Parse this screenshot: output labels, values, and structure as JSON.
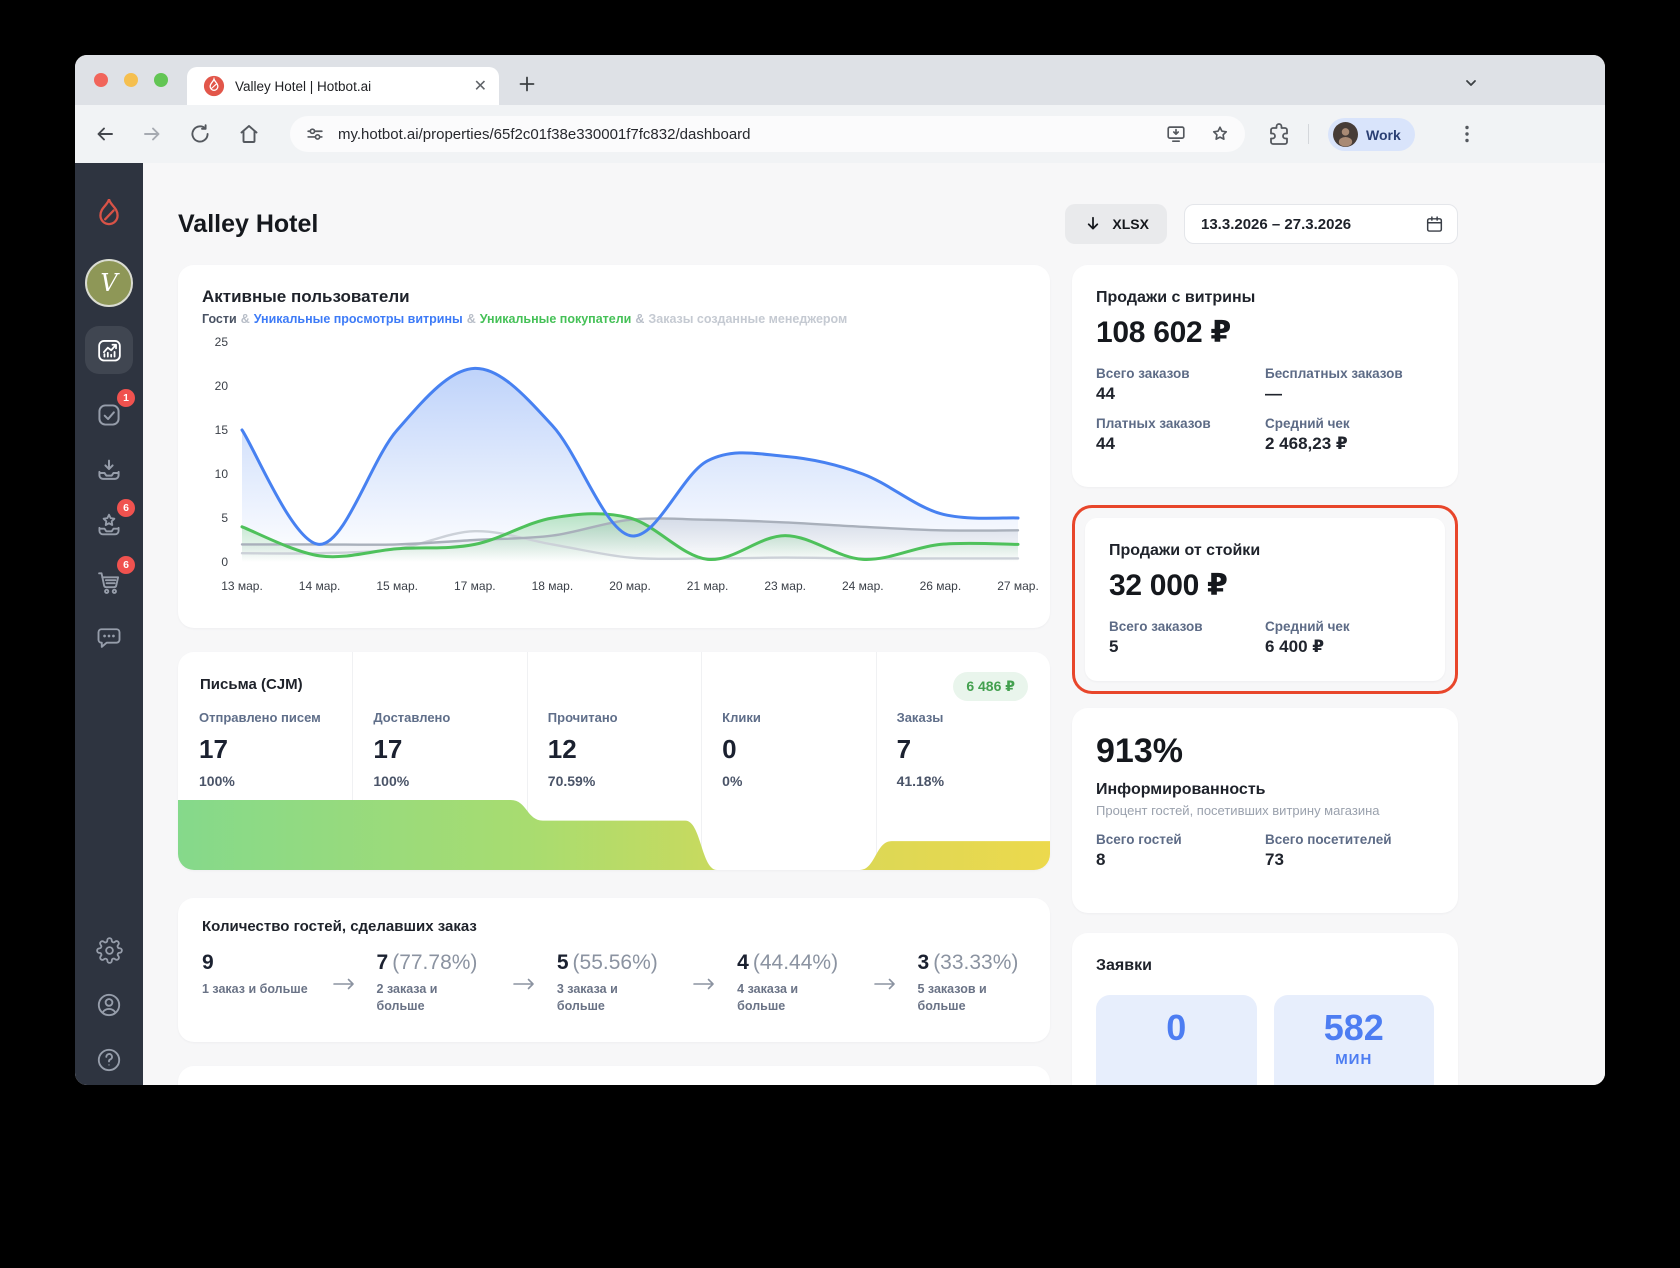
{
  "browser": {
    "tab_title": "Valley Hotel | Hotbot.ai",
    "url": "my.hotbot.ai/properties/65f2c01f38e330001f7fc832/dashboard",
    "profile_label": "Work"
  },
  "sidebar": {
    "tasks_badge": "1",
    "loyalty_badge": "6",
    "cart_badge": "6"
  },
  "header": {
    "title": "Valley Hotel",
    "xlsx_label": "XLSX",
    "date_range": "13.3.2026 – 27.3.2026"
  },
  "chart_data": {
    "type": "area",
    "title": "Активные пользователи",
    "separator": "&",
    "x_labels": [
      "13 мар.",
      "14 мар.",
      "15 мар.",
      "17 мар.",
      "18 мар.",
      "20 мар.",
      "21 мар.",
      "23 мар.",
      "24 мар.",
      "26 мар.",
      "27 мар."
    ],
    "ylim": [
      0,
      25
    ],
    "yticks": [
      0,
      5,
      10,
      15,
      20,
      25
    ],
    "series": [
      {
        "name": "Гости",
        "color": "#a9b0bb",
        "legend_color": "#495263",
        "fill": true,
        "values": [
          2,
          2,
          2,
          2.5,
          3,
          4.8,
          4.8,
          4.5,
          4,
          3.6,
          3.6
        ]
      },
      {
        "name": "Уникальные просмотры витрины",
        "color": "#4781f1",
        "legend_color": "#3d7bf7",
        "fill": true,
        "values": [
          15,
          2,
          15,
          22,
          15.5,
          3,
          11.5,
          12,
          10,
          5.5,
          5
        ]
      },
      {
        "name": "Уникальные покупатели",
        "color": "#4ec15b",
        "legend_color": "#45c157",
        "fill": true,
        "values": [
          4,
          0.7,
          1.5,
          2,
          5,
          5,
          0.3,
          3,
          0.3,
          2,
          2
        ]
      },
      {
        "name": "Заказы созданные менеджером",
        "color": "#ccd1d8",
        "legend_color": "#c5cad2",
        "fill": false,
        "values": [
          1,
          1,
          1.5,
          3.5,
          2,
          0.5,
          0.4,
          0.5,
          0.4,
          0.4,
          0.4
        ]
      }
    ]
  },
  "cjm": {
    "title": "Письма (CJM)",
    "badge": "6 486 ₽",
    "steps": [
      {
        "label": "Отправлено писем",
        "value": "17",
        "pct": "100%"
      },
      {
        "label": "Доставлено",
        "value": "17",
        "pct": "100%"
      },
      {
        "label": "Прочитано",
        "value": "12",
        "pct": "70.59%"
      },
      {
        "label": "Клики",
        "value": "0",
        "pct": "0%"
      },
      {
        "label": "Заказы",
        "value": "7",
        "pct": "41.18%"
      }
    ]
  },
  "guests_funnel": {
    "title": "Количество гостей, сделавших заказ",
    "steps": [
      {
        "value": "9",
        "pct": "",
        "label": "1 заказ и больше"
      },
      {
        "value": "7",
        "pct": "(77.78%)",
        "label": "2 заказа и больше"
      },
      {
        "value": "5",
        "pct": "(55.56%)",
        "label": "3 заказа и больше"
      },
      {
        "value": "4",
        "pct": "(44.44%)",
        "label": "4 заказа и больше"
      },
      {
        "value": "3",
        "pct": "(33.33%)",
        "label": "5 заказов и больше"
      }
    ]
  },
  "cards": {
    "showcase": {
      "title": "Продажи с витрины",
      "amount": "108 602 ₽",
      "stats": [
        {
          "label": "Всего заказов",
          "value": "44"
        },
        {
          "label": "Бесплатных заказов",
          "value": "—"
        },
        {
          "label": "Платных заказов",
          "value": "44"
        },
        {
          "label": "Средний чек",
          "value": "2 468,23 ₽"
        }
      ]
    },
    "desk": {
      "title": "Продажи от стойки",
      "amount": "32 000 ₽",
      "stats": [
        {
          "label": "Всего заказов",
          "value": "5"
        },
        {
          "label": "Средний чек",
          "value": "6 400 ₽"
        }
      ]
    },
    "awareness": {
      "value": "913%",
      "title": "Информированность",
      "subtitle": "Процент гостей, посетивших витрину магазина",
      "stats": [
        {
          "label": "Всего гостей",
          "value": "8"
        },
        {
          "label": "Всего посетителей",
          "value": "73"
        }
      ]
    },
    "requests": {
      "title": "Заявки",
      "tiles": [
        {
          "value": "0",
          "unit": ""
        },
        {
          "value": "582",
          "unit": "МИН"
        }
      ]
    }
  },
  "colors": {
    "accent_blue": "#4d7df2",
    "accent_green": "#45c157",
    "highlight_red": "#e8462b",
    "badge_red": "#f0524f"
  }
}
